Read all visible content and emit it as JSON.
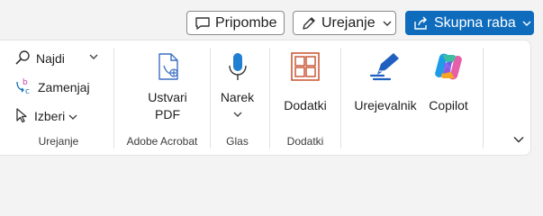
{
  "topbar": {
    "comments_label": "Pripombe",
    "editing_label": "Urejanje",
    "share_label": "Skupna raba"
  },
  "ribbon": {
    "editing_group": {
      "find_label": "Najdi",
      "replace_label": "Zamenjaj",
      "select_label": "Izberi",
      "group_label": "Urejanje"
    },
    "acrobat_group": {
      "create_pdf_line1": "Ustvari",
      "create_pdf_line2": "PDF",
      "group_label": "Adobe Acrobat"
    },
    "voice_group": {
      "dictate_label": "Narek",
      "group_label": "Glas"
    },
    "addins_group": {
      "addins_label": "Dodatki",
      "group_label": "Dodatki"
    },
    "tools_group": {
      "editor_label": "Urejevalnik",
      "copilot_label": "Copilot"
    }
  },
  "colors": {
    "primary": "#0f6cbd",
    "acrobat": "#3b6fc2",
    "addins": "#c8502d"
  }
}
